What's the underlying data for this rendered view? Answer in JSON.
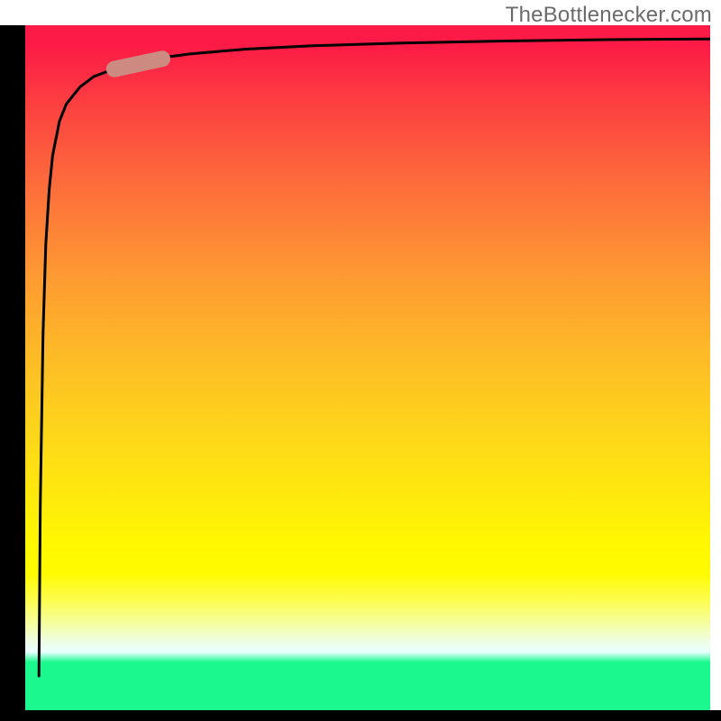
{
  "watermark": "TheBottlenecker.com",
  "chart_data": {
    "type": "line",
    "title": "",
    "xlabel": "",
    "ylabel": "",
    "xlim": [
      0,
      100
    ],
    "ylim": [
      0,
      100
    ],
    "series": [
      {
        "name": "curve",
        "x": [
          2,
          2.2,
          2.6,
          3,
          3.5,
          4,
          5,
          6,
          8,
          10,
          14,
          18,
          24,
          32,
          42,
          55,
          70,
          85,
          100
        ],
        "y": [
          5,
          30,
          55,
          68,
          76,
          81,
          86,
          88.5,
          91,
          92.5,
          94,
          95,
          95.8,
          96.5,
          97,
          97.4,
          97.7,
          97.9,
          98
        ]
      }
    ],
    "highlight_segment": {
      "x_start": 13,
      "x_end": 20,
      "y_start": 93.6,
      "y_end": 95.1,
      "color": "#cd8a80"
    },
    "background_gradient": {
      "top": "#fc1b46",
      "mid1": "#fd9832",
      "mid2": "#fff800",
      "bottom": "#1bf98e"
    }
  }
}
